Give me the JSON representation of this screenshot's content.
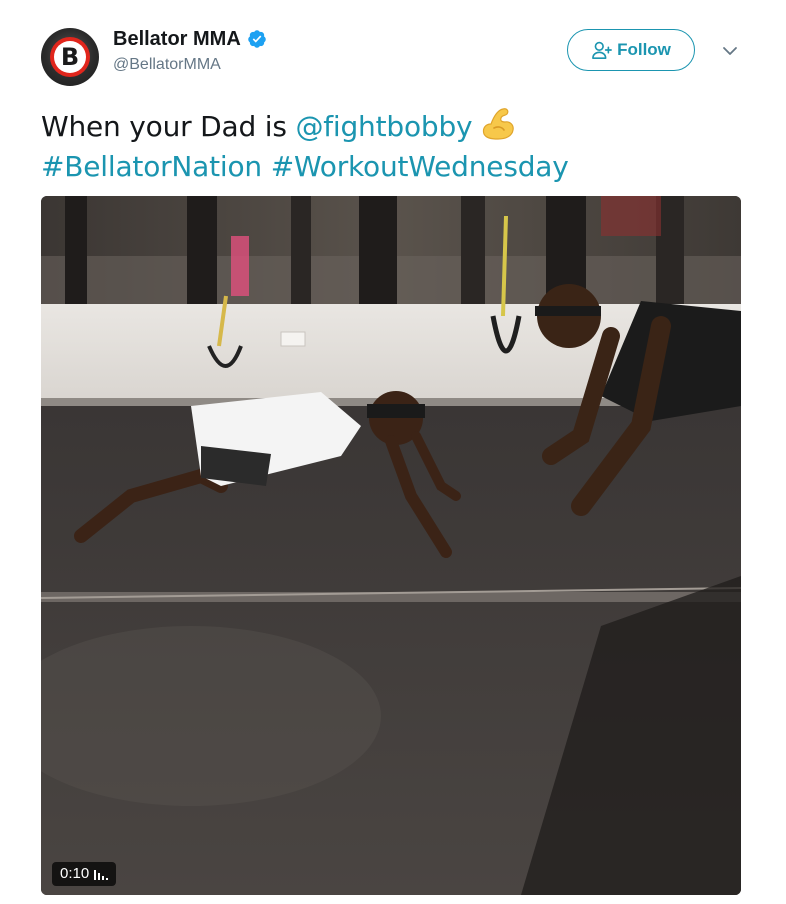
{
  "account": {
    "display_name": "Bellator MMA",
    "handle": "@BellatorMMA",
    "avatar_letter": "B",
    "verified": true
  },
  "actions": {
    "follow_label": "Follow",
    "menu_icon": "chevron-down-icon"
  },
  "tweet": {
    "text_prefix": "When your Dad is ",
    "mention": "@fightbobby",
    "emoji": "flexed-biceps-emoji",
    "hashtag_1": "#BellatorNation",
    "hashtag_2": "#WorkoutWednesday"
  },
  "media": {
    "type": "video",
    "duration": "0:10",
    "duration_icon": "audio-bars-icon"
  },
  "colors": {
    "link": "#1b95b0",
    "text": "#14171a",
    "secondary_text": "#657786",
    "verified": "#1da1f2",
    "brand_red": "#e1261c"
  }
}
